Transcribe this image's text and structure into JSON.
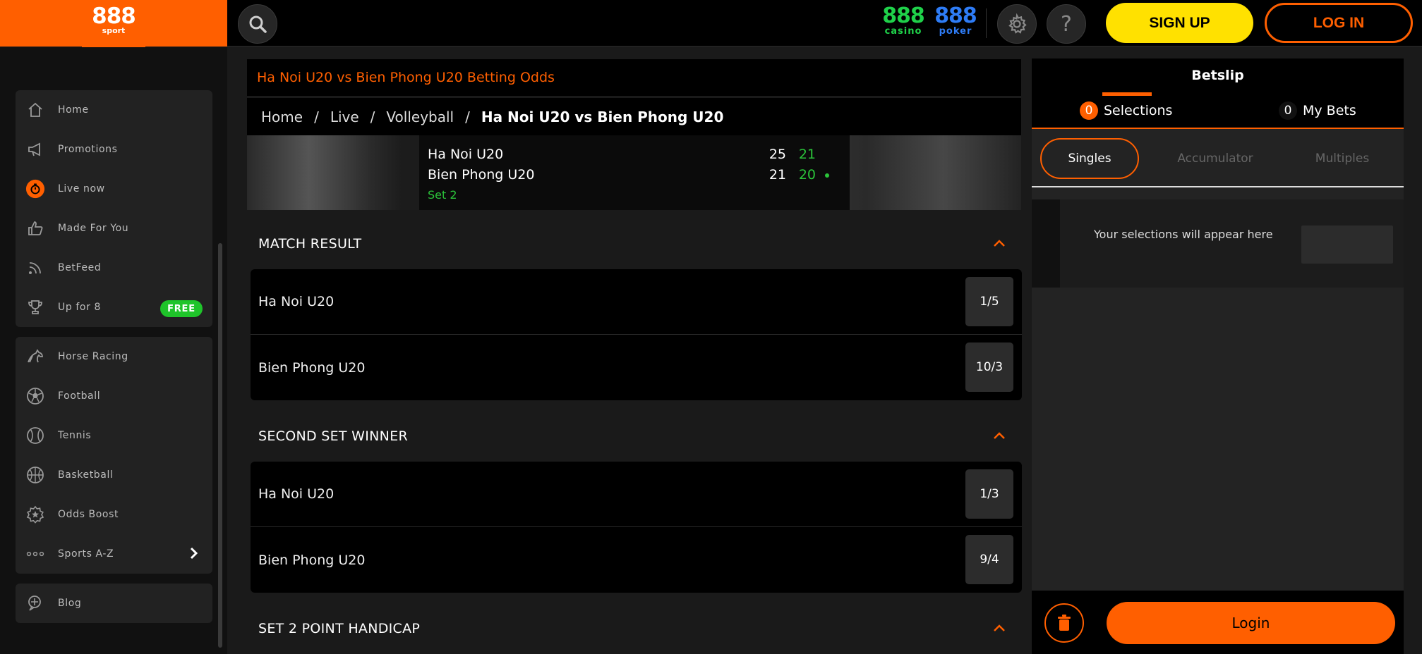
{
  "logo": {
    "main": "888",
    "sub": "sport"
  },
  "brands": {
    "casino": {
      "num": "888",
      "sub": "casino",
      "color": "#1fd14a"
    },
    "poker": {
      "num": "888",
      "sub": "poker",
      "color": "#2e7cf6"
    }
  },
  "header": {
    "signup_label": "SIGN UP",
    "login_label": "LOG IN",
    "help_glyph": "?"
  },
  "sidebar": {
    "group1": [
      {
        "label": "Home",
        "icon": "home-icon"
      },
      {
        "label": "Promotions",
        "icon": "megaphone-icon"
      },
      {
        "label": "Live now",
        "icon": "live-icon"
      },
      {
        "label": "Made For You",
        "icon": "thumbs-up-icon"
      },
      {
        "label": "BetFeed",
        "icon": "feed-icon"
      },
      {
        "label": "Up for 8",
        "icon": "trophy-icon",
        "badge": "FREE"
      }
    ],
    "group2": [
      {
        "label": "Horse Racing",
        "icon": "horse-icon"
      },
      {
        "label": "Football",
        "icon": "football-icon"
      },
      {
        "label": "Tennis",
        "icon": "tennis-icon"
      },
      {
        "label": "Basketball",
        "icon": "basketball-icon"
      },
      {
        "label": "Odds Boost",
        "icon": "odds-boost-icon"
      },
      {
        "label": "Sports A-Z",
        "icon": "dots-icon"
      }
    ],
    "group3": [
      {
        "label": "Blog",
        "icon": "blog-icon"
      }
    ]
  },
  "event": {
    "title": "Ha Noi U20 vs Bien Phong U20 Betting Odds",
    "breadcrumb": [
      "Home",
      "Live",
      "Volleyball",
      "Ha Noi U20 vs Bien Phong U20"
    ],
    "breadcrumb_sep": "/",
    "team1": "Ha Noi U20",
    "team2": "Bien Phong U20",
    "set_label": "Set 2",
    "score": {
      "team1_set1": "25",
      "team1_set2": "21",
      "team2_set1": "21",
      "team2_set2": "20"
    }
  },
  "markets": [
    {
      "title": "MATCH RESULT",
      "selections": [
        {
          "name": "Ha Noi U20",
          "odds": "1/5"
        },
        {
          "name": "Bien Phong U20",
          "odds": "10/3"
        }
      ]
    },
    {
      "title": "SECOND SET WINNER",
      "selections": [
        {
          "name": "Ha Noi U20",
          "odds": "1/3"
        },
        {
          "name": "Bien Phong U20",
          "odds": "9/4"
        }
      ]
    },
    {
      "title": "SET 2 POINT HANDICAP",
      "selections": []
    }
  ],
  "betslip": {
    "title": "Betslip",
    "tabs": {
      "selections_count": "0",
      "selections_label": "Selections",
      "mybets_count": "0",
      "mybets_label": "My Bets"
    },
    "subtabs": {
      "singles": "Singles",
      "accumulator": "Accumulator",
      "multiples": "Multiples"
    },
    "empty_message": "Your selections will appear here",
    "login_label": "Login"
  },
  "colors": {
    "accent": "#ff5f00",
    "signup": "#ffe100",
    "live_green": "#2bc43a",
    "free_badge": "#1fc42a"
  }
}
